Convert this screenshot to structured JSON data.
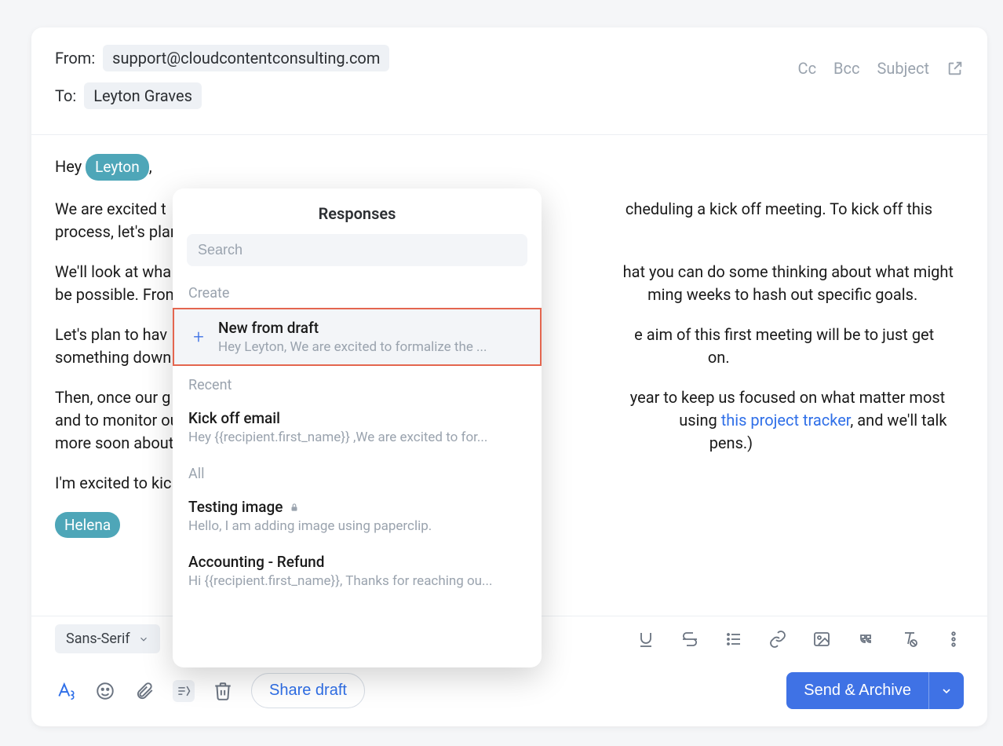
{
  "header": {
    "from_label": "From:",
    "from_value": "support@cloudcontentconsulting.com",
    "to_label": "To:",
    "to_value": "Leyton Graves",
    "cc": "Cc",
    "bcc": "Bcc",
    "subject": "Subject"
  },
  "body": {
    "greeting_prefix": "Hey ",
    "greeting_pill": "Leyton",
    "greeting_suffix": ",",
    "p1_a": "We are excited t",
    "p1_b": "cheduling a kick off meeting. To kick off this process, let's plan to mee",
    "p2_a": "We'll look at wha",
    "p2_b": "hat you can do some thinking about what might be possible. From t",
    "p2_c": "ming weeks to hash out specific goals.",
    "p3_a": "Let's plan to hav",
    "p3_b": "e aim of this first meeting will be to just get something down on paper s",
    "p3_c": "on.",
    "p4_a": "Then, once our g",
    "p4_b": "year to keep us focused on what matter most and to monitor our prog",
    "p4_c": "using ",
    "p4_link": "this project tracker",
    "p4_d": ", and we'll talk more soon about making su",
    "p4_e": "pens.)",
    "p5": "I'm excited to kic",
    "sig_pill": "Helena"
  },
  "toolbar": {
    "font": "Sans-Serif",
    "share_draft": "Share draft",
    "send": "Send & Archive"
  },
  "popover": {
    "title": "Responses",
    "search_placeholder": "Search",
    "create_label": "Create",
    "new_from_draft_title": "New from draft",
    "new_from_draft_preview": "Hey Leyton, We are excited to formalize the ...",
    "recent_label": "Recent",
    "kickoff_title": "Kick off email",
    "kickoff_preview": "Hey {{recipient.first_name}} ,We are excited to for...",
    "all_label": "All",
    "testing_title": "Testing image",
    "testing_preview": "Hello, I am adding image using paperclip.",
    "acct_title": "Accounting - Refund",
    "acct_preview": "Hi {{recipient.first_name}}, Thanks for reaching ou..."
  }
}
